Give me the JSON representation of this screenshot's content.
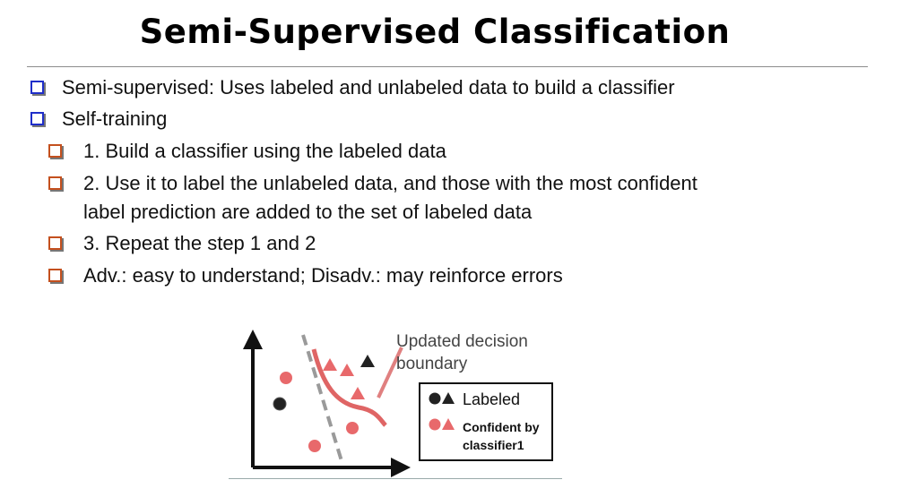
{
  "slide": {
    "title": "Semi-Supervised Classification",
    "bullets": [
      {
        "text": "Semi-supervised: Uses labeled and unlabeled data to build a classifier"
      },
      {
        "text": "Self-training"
      }
    ],
    "sub_bullets": [
      {
        "text": "1. Build a classifier using the labeled data"
      },
      {
        "line1": "2. Use it to label the unlabeled data, and those with the most confident",
        "line2": "label prediction are added to the set of labeled data"
      },
      {
        "text": "3. Repeat the step 1 and 2"
      },
      {
        "text": "Adv.: easy to understand; Disadv.: may reinforce errors"
      }
    ]
  },
  "figure": {
    "annotation_line1": "Updated decision",
    "annotation_line2": "boundary",
    "legend_labeled": "Labeled",
    "legend_confident_line1": "Confident by",
    "legend_confident_line2": "classifier1",
    "colors": {
      "labeled": "#222222",
      "confident": "#e8696b",
      "boundary": "#d94a4a",
      "dashed": "#999999"
    }
  }
}
